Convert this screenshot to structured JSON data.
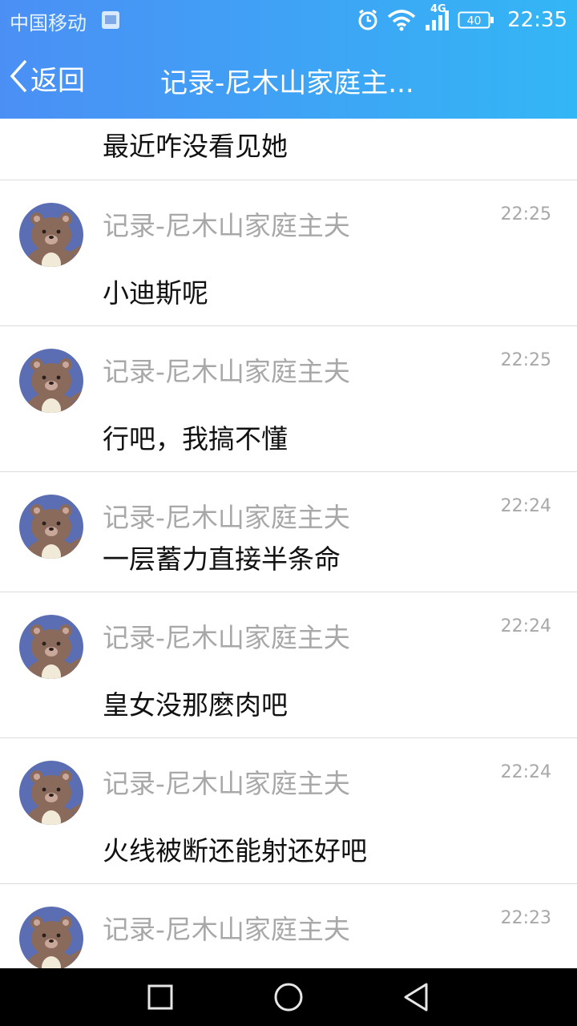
{
  "status_bar": {
    "carrier": "中国移动",
    "network_type": "4G",
    "battery": "40",
    "time": "22:35"
  },
  "header": {
    "back_label": "返回",
    "title": "记录-尼木山家庭主..."
  },
  "messages": [
    {
      "sender": "",
      "time": "",
      "text": "最近咋没看见她"
    },
    {
      "sender": "记录-尼木山家庭主夫",
      "time": "22:25",
      "text": "小迪斯呢"
    },
    {
      "sender": "记录-尼木山家庭主夫",
      "time": "22:25",
      "text": "行吧，我搞不懂"
    },
    {
      "sender": "记录-尼木山家庭主夫",
      "time": "22:24",
      "text": "一层蓄力直接半条命"
    },
    {
      "sender": "记录-尼木山家庭主夫",
      "time": "22:24",
      "text": "皇女没那麽肉吧"
    },
    {
      "sender": "记录-尼木山家庭主夫",
      "time": "22:24",
      "text": "火线被断还能射还好吧"
    },
    {
      "sender": "记录-尼木山家庭主夫",
      "time": "22:23",
      "text": ""
    }
  ],
  "nav": {
    "recent_icon": "square-icon",
    "home_icon": "circle-icon",
    "back_icon": "triangle-back-icon"
  },
  "colors": {
    "header_start": "#4b8ff5",
    "header_end": "#33b6f5",
    "avatar_bg": "#5b6eb3",
    "bear": "#8a6a5a"
  }
}
